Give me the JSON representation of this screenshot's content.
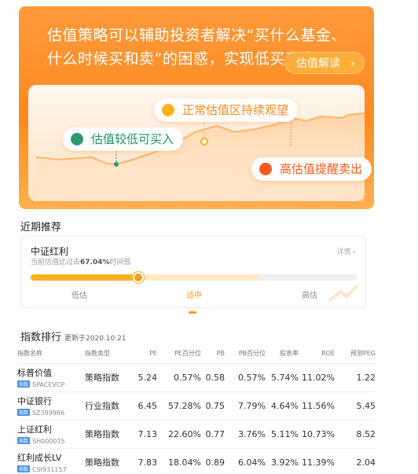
{
  "banner": {
    "title": "估值策略可以辅助投资者解决“买什么基金、什么时候买和卖”的困惑，实现低买高卖。",
    "guide_button": "估值解读",
    "labels": {
      "low": "估值较低可买入",
      "normal": "正常估值区持续观望",
      "high": "高估值提醒卖出"
    },
    "colors": {
      "low": "#2e9a74",
      "normal": "#ffb020",
      "high": "#ff5a1f"
    }
  },
  "recommend": {
    "section_title": "近期推荐",
    "name": "中证红利",
    "desc_prefix": "当前估值比过去",
    "desc_pct": "67.04%",
    "desc_suffix": "时间低",
    "detail": "详情",
    "position_pct": 33,
    "levels": [
      "低估",
      "适中",
      "高估"
    ]
  },
  "ranking": {
    "section_title": "指数排行",
    "updated": "更新于2020.10.21",
    "headers": [
      "指数名称",
      "指数类型",
      "PE",
      "PE百分位",
      "PB",
      "PB百分位",
      "股息率",
      "ROE",
      "预测PEG"
    ],
    "tag": "指数",
    "rows": [
      {
        "name": "标普价值",
        "code": "SPACEVCP",
        "type": "策略指数",
        "pe": "5.24",
        "pe_pct": "0.57%",
        "pb": "0.58",
        "pb_pct": "0.57%",
        "yield": "5.74%",
        "roe": "11.02%",
        "peg": "1.22"
      },
      {
        "name": "中证银行",
        "code": "SZ399986",
        "type": "行业指数",
        "pe": "6.45",
        "pe_pct": "57.28%",
        "pb": "0.75",
        "pb_pct": "7.79%",
        "yield": "4.64%",
        "roe": "11.56%",
        "peg": "5.45"
      },
      {
        "name": "上证红利",
        "code": "SH000015",
        "type": "策略指数",
        "pe": "7.13",
        "pe_pct": "22.60%",
        "pb": "0.77",
        "pb_pct": "3.76%",
        "yield": "5.11%",
        "roe": "10.73%",
        "peg": "8.52"
      },
      {
        "name": "红利成长LV",
        "code": "CSI931157",
        "type": "策略指数",
        "pe": "7.83",
        "pe_pct": "18.04%",
        "pb": "0.89",
        "pb_pct": "6.04%",
        "yield": "3.92%",
        "roe": "11.39%",
        "peg": "2.04"
      }
    ]
  }
}
